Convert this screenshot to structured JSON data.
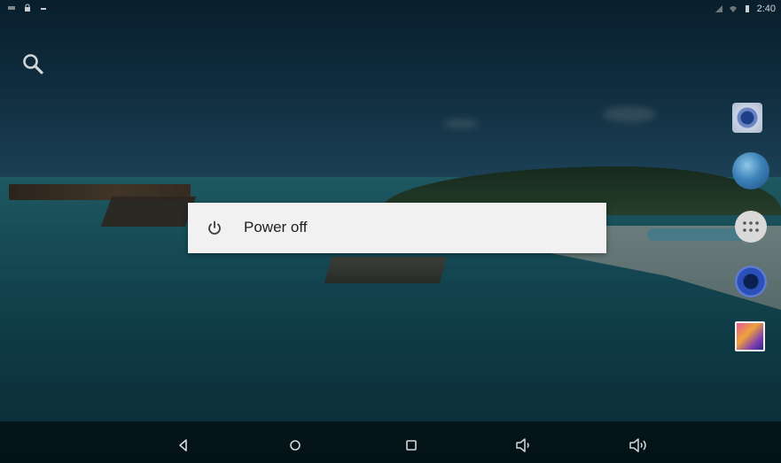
{
  "status_bar": {
    "left_icons": [
      "notification-icon",
      "lock-icon",
      "minus-icon"
    ],
    "right_icons": [
      "signal-icon",
      "wifi-icon",
      "battery-icon"
    ],
    "time": "2:40"
  },
  "dialog": {
    "power_off_label": "Power off",
    "icon": "power-icon"
  },
  "dock": [
    "camera-icon",
    "browser-globe-icon",
    "all-apps-icon",
    "music-icon",
    "gallery-icon"
  ],
  "navbar": [
    "back-icon",
    "home-icon",
    "recents-icon",
    "volume-down-icon",
    "volume-up-icon"
  ],
  "colors": {
    "dialog_bg": "#f1f1f1",
    "dialog_text": "#212121",
    "nav_icon": "#d8d8d8"
  }
}
